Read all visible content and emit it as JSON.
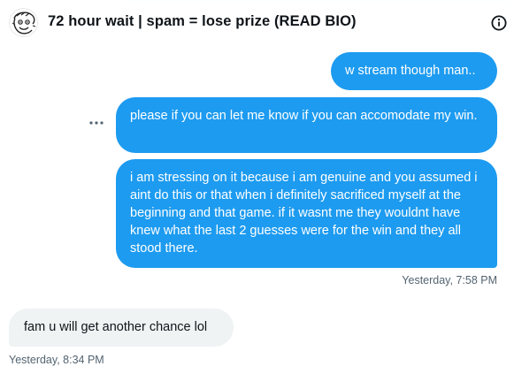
{
  "conversation": {
    "title": "72 hour wait | spam = lose prize (READ BIO)",
    "avatar_icon": "doodle-face-avatar",
    "info_icon": "info-icon"
  },
  "messages": [
    {
      "direction": "sent",
      "text": "w stream though man.."
    },
    {
      "direction": "sent",
      "text": "please if you can let me know if you can accomodate my win."
    },
    {
      "direction": "sent",
      "text": "i am stressing on it because i am genuine and you assumed i aint do this or that when i definitely sacrificed myself at the beginning and that game. if it wasnt me they wouldnt have knew what the last 2 guesses were for the win and they all stood there."
    },
    {
      "direction": "received",
      "text": "fam u will get another chance lol"
    }
  ],
  "timestamps": {
    "sent_group": "Yesterday, 7:58 PM",
    "received": "Yesterday, 8:34 PM"
  },
  "colors": {
    "sent_bubble": "#1d9bf0",
    "received_bubble": "#eff3f4",
    "muted_text": "#536471"
  }
}
